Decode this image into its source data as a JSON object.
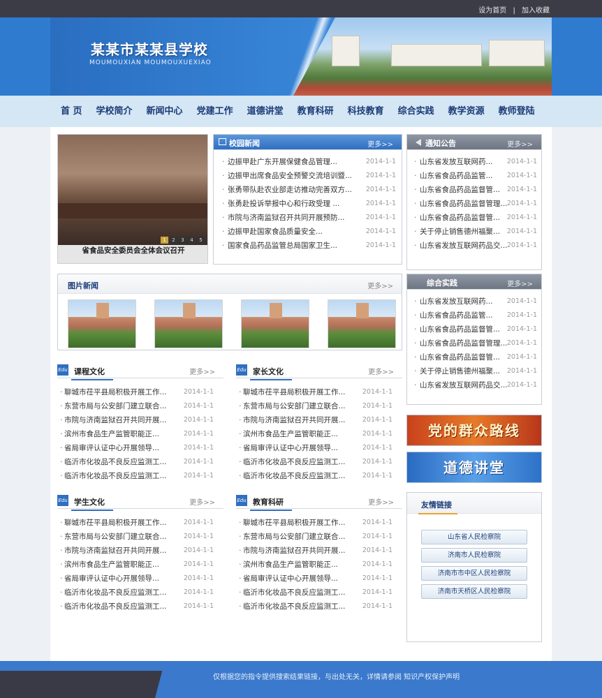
{
  "toplinks": [
    "设为首页",
    "|",
    "加入收藏"
  ],
  "site": {
    "title": "某某市某某县学校",
    "subtitle": "MOUMOUXIAN  MOUMOUXUEXIAO"
  },
  "nav": [
    "首 页",
    "学校简介",
    "新闻中心",
    "党建工作",
    "道德讲堂",
    "教育科研",
    "科技教育",
    "综合实践",
    "教学资源",
    "教师登陆"
  ],
  "featured": {
    "caption": "省食品安全委员会全体会议召开",
    "pager": [
      "1",
      "2",
      "3",
      "4",
      "5"
    ]
  },
  "campus_news": {
    "title": "校园新闻",
    "more": "更多>>",
    "items": [
      {
        "t": "边振甲赴广东开展保健食品管理...",
        "d": "2014-1-1"
      },
      {
        "t": "边振甲出席食品安全预警交流培训暨...",
        "d": "2014-1-1"
      },
      {
        "t": "张勇带队赴农业部走访推动完善双方...",
        "d": "2014-1-1"
      },
      {
        "t": "张勇赴投诉举报中心和行政受理 ...",
        "d": "2014-1-1"
      },
      {
        "t": "市院与济南监狱召开共同开展预防...",
        "d": "2014-1-1"
      },
      {
        "t": "边振甲赴国家食品质量安全...",
        "d": "2014-1-1"
      },
      {
        "t": "国家食品药品监管总局国家卫生...",
        "d": "2014-1-1"
      }
    ]
  },
  "notice": {
    "title": "通知公告",
    "more": "更多>>",
    "items": [
      {
        "t": "山东省发放互联网药...",
        "d": "2014-1-1"
      },
      {
        "t": "山东省食品药品监管...",
        "d": "2014-1-1"
      },
      {
        "t": "山东省食品药品监督管...",
        "d": "2014-1-1"
      },
      {
        "t": "山东省食品药品监督管理...",
        "d": "2014-1-1"
      },
      {
        "t": "山东省食品药品监督管...",
        "d": "2014-1-1"
      },
      {
        "t": "关于停止销售德州福聚...",
        "d": "2014-1-1"
      },
      {
        "t": "山东省发放互联网药品交...",
        "d": "2014-1-1"
      }
    ]
  },
  "picnews": {
    "title": "图片新闻",
    "more": "更多>>"
  },
  "practice": {
    "title": "综合实践",
    "more": "更多>>",
    "items": [
      {
        "t": "山东省发放互联网药...",
        "d": "2014-1-1"
      },
      {
        "t": "山东省食品药品监管...",
        "d": "2014-1-1"
      },
      {
        "t": "山东省食品药品监督管...",
        "d": "2014-1-1"
      },
      {
        "t": "山东省食品药品监督管理...",
        "d": "2014-1-1"
      },
      {
        "t": "山东省食品药品监督管...",
        "d": "2014-1-1"
      },
      {
        "t": "关于停止销售德州福聚...",
        "d": "2014-1-1"
      },
      {
        "t": "山东省发放互联网药品交...",
        "d": "2014-1-1"
      }
    ]
  },
  "sections": {
    "edu_tag": "Edu",
    "more": "更多>>",
    "course": {
      "title": "课程文化"
    },
    "parent": {
      "title": "家长文化"
    },
    "student": {
      "title": "学生文化"
    },
    "research": {
      "title": "教育科研"
    },
    "items": [
      {
        "t": "聊城市茌平县局积极开展工作...",
        "d": "2014-1-1"
      },
      {
        "t": "东营市局与公安部门建立联合...",
        "d": "2014-1-1"
      },
      {
        "t": "市院与济南监狱召开共同开展...",
        "d": "2014-1-1"
      },
      {
        "t": "滨州市食品生产监管职能正...",
        "d": "2014-1-1"
      },
      {
        "t": "省局审评认证中心开展领导...",
        "d": "2014-1-1"
      },
      {
        "t": "临沂市化妆品不良反应监测工...",
        "d": "2014-1-1"
      },
      {
        "t": "临沂市化妆品不良反应监测工...",
        "d": "2014-1-1"
      }
    ]
  },
  "ads": {
    "party": "党的群众路线",
    "moral": "道德讲堂"
  },
  "links": {
    "title": "友情链接",
    "items": [
      "山东省人民检察院",
      "济南市人民检察院",
      "济南市市中区人民检察院",
      "济南市天桥区人民检察院"
    ]
  },
  "footer": {
    "text": "仅根据您的指令提供搜索结果链接，与出处无关，详情请参阅 知识产权保护声明"
  }
}
